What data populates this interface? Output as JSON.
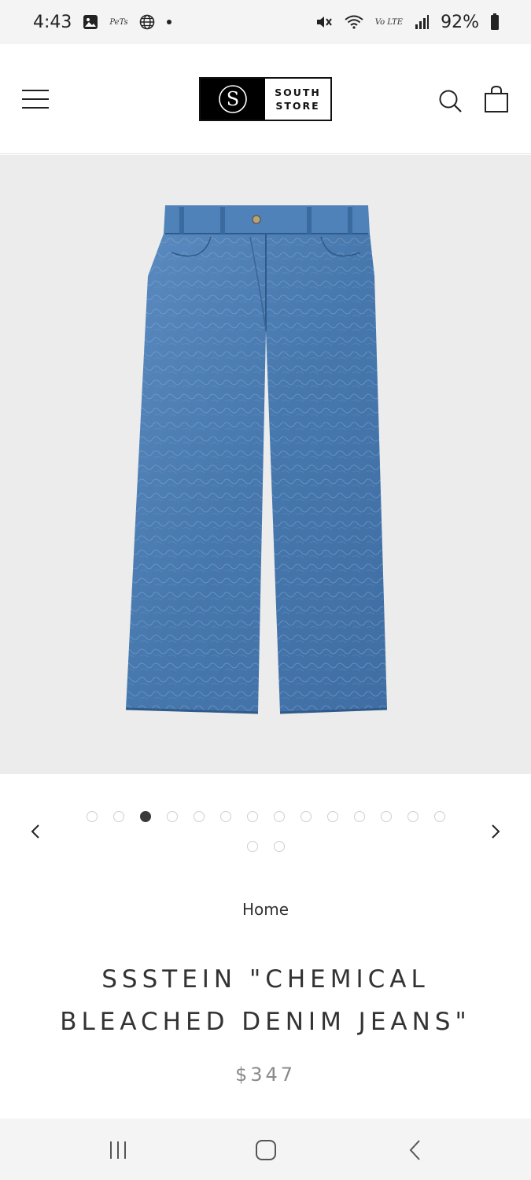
{
  "status_bar": {
    "time": "4:43",
    "mini_label": "PeTs",
    "battery": "92%",
    "network_label": "Vo LTE",
    "icons": [
      "gallery-icon",
      "app-notification-icon",
      "globe-icon",
      "dot-icon",
      "mute-icon",
      "wifi-icon",
      "volte-icon",
      "signal-icon",
      "battery-icon"
    ]
  },
  "header": {
    "logo_letter": "S",
    "logo_line1": "SOUTH",
    "logo_line2": "STORE",
    "icons": [
      "menu-icon",
      "search-icon",
      "cart-icon"
    ]
  },
  "product": {
    "image_alt": "SSSTEIN CHEMICAL BLEACHED DENIM JEANS",
    "breadcrumb": "Home",
    "title": "SSSTEIN \"CHEMICAL BLEACHED DENIM JEANS\"",
    "price": "$347"
  },
  "carousel": {
    "total_images": 16,
    "active_index": 3,
    "prev_icon": "chevron-left-icon",
    "next_icon": "chevron-right-icon"
  },
  "nav_bar": {
    "icons": [
      "recents-icon",
      "home-icon",
      "back-icon"
    ]
  },
  "colors": {
    "denim": "#4a7bb0",
    "background_gray": "#ececec",
    "price_gray": "#8a8a8a"
  }
}
